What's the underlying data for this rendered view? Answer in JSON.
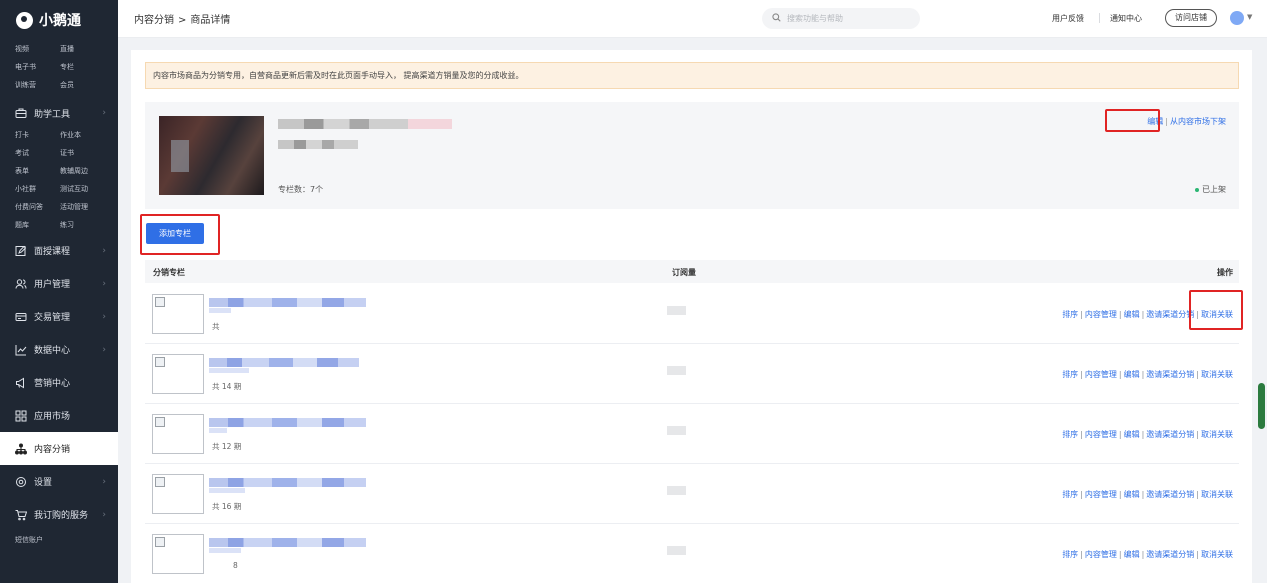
{
  "app": {
    "name": "小鹅通"
  },
  "sidebar": {
    "top_grid": [
      "视频",
      "直播",
      "电子书",
      "专栏",
      "训练营",
      "会员"
    ],
    "tools_label": "助学工具",
    "tools_grid": [
      "打卡",
      "作业本",
      "考试",
      "证书",
      "表单",
      "教辅周边",
      "小社群",
      "测试互动",
      "付费问答",
      "活动管理",
      "题库",
      "练习"
    ],
    "items": [
      {
        "label": "面授课程",
        "icon": "edit-icon"
      },
      {
        "label": "用户管理",
        "icon": "users-icon"
      },
      {
        "label": "交易管理",
        "icon": "card-icon"
      },
      {
        "label": "数据中心",
        "icon": "chart-icon"
      },
      {
        "label": "营销中心",
        "icon": "megaphone-icon"
      },
      {
        "label": "应用市场",
        "icon": "apps-icon"
      },
      {
        "label": "内容分销",
        "icon": "share-tree-icon"
      },
      {
        "label": "设置",
        "icon": "gear-icon"
      },
      {
        "label": "我订购的服务",
        "icon": "cart-icon"
      }
    ],
    "bottom": "短信账户"
  },
  "topbar": {
    "breadcrumb": [
      "内容分销",
      ">",
      "商品详情"
    ],
    "search_placeholder": "搜索功能与帮助",
    "links": [
      "用户反馈",
      "通知中心"
    ],
    "visit_store": "访问店铺"
  },
  "notice": "内容市场商品为分销专用，自营商品更新后需及时在此页面手动导入， 提高渠道方销量及您的分成收益。",
  "product": {
    "column_count": "专栏数：7个",
    "edit": "编辑",
    "separator": "|",
    "remove": "从内容市场下架",
    "status": "已上架",
    "status_color": "#2bb673"
  },
  "add_button": "添加专栏",
  "table": {
    "headers": [
      "分销专栏",
      "订阅量",
      "操作"
    ],
    "rows": [
      {
        "issues": "共"
      },
      {
        "issues": "共 14 期"
      },
      {
        "issues": "共 12 期"
      },
      {
        "issues": "共 16 期"
      },
      {
        "issues": "8"
      }
    ],
    "ops": [
      "排序",
      "内容管理",
      "编辑",
      "邀请渠道分销",
      "取消关联"
    ],
    "ops_separator": "|"
  },
  "colors": {
    "accent": "#2f6fe6",
    "sidebar_bg": "#1f2733",
    "highlight": "#e02424"
  }
}
